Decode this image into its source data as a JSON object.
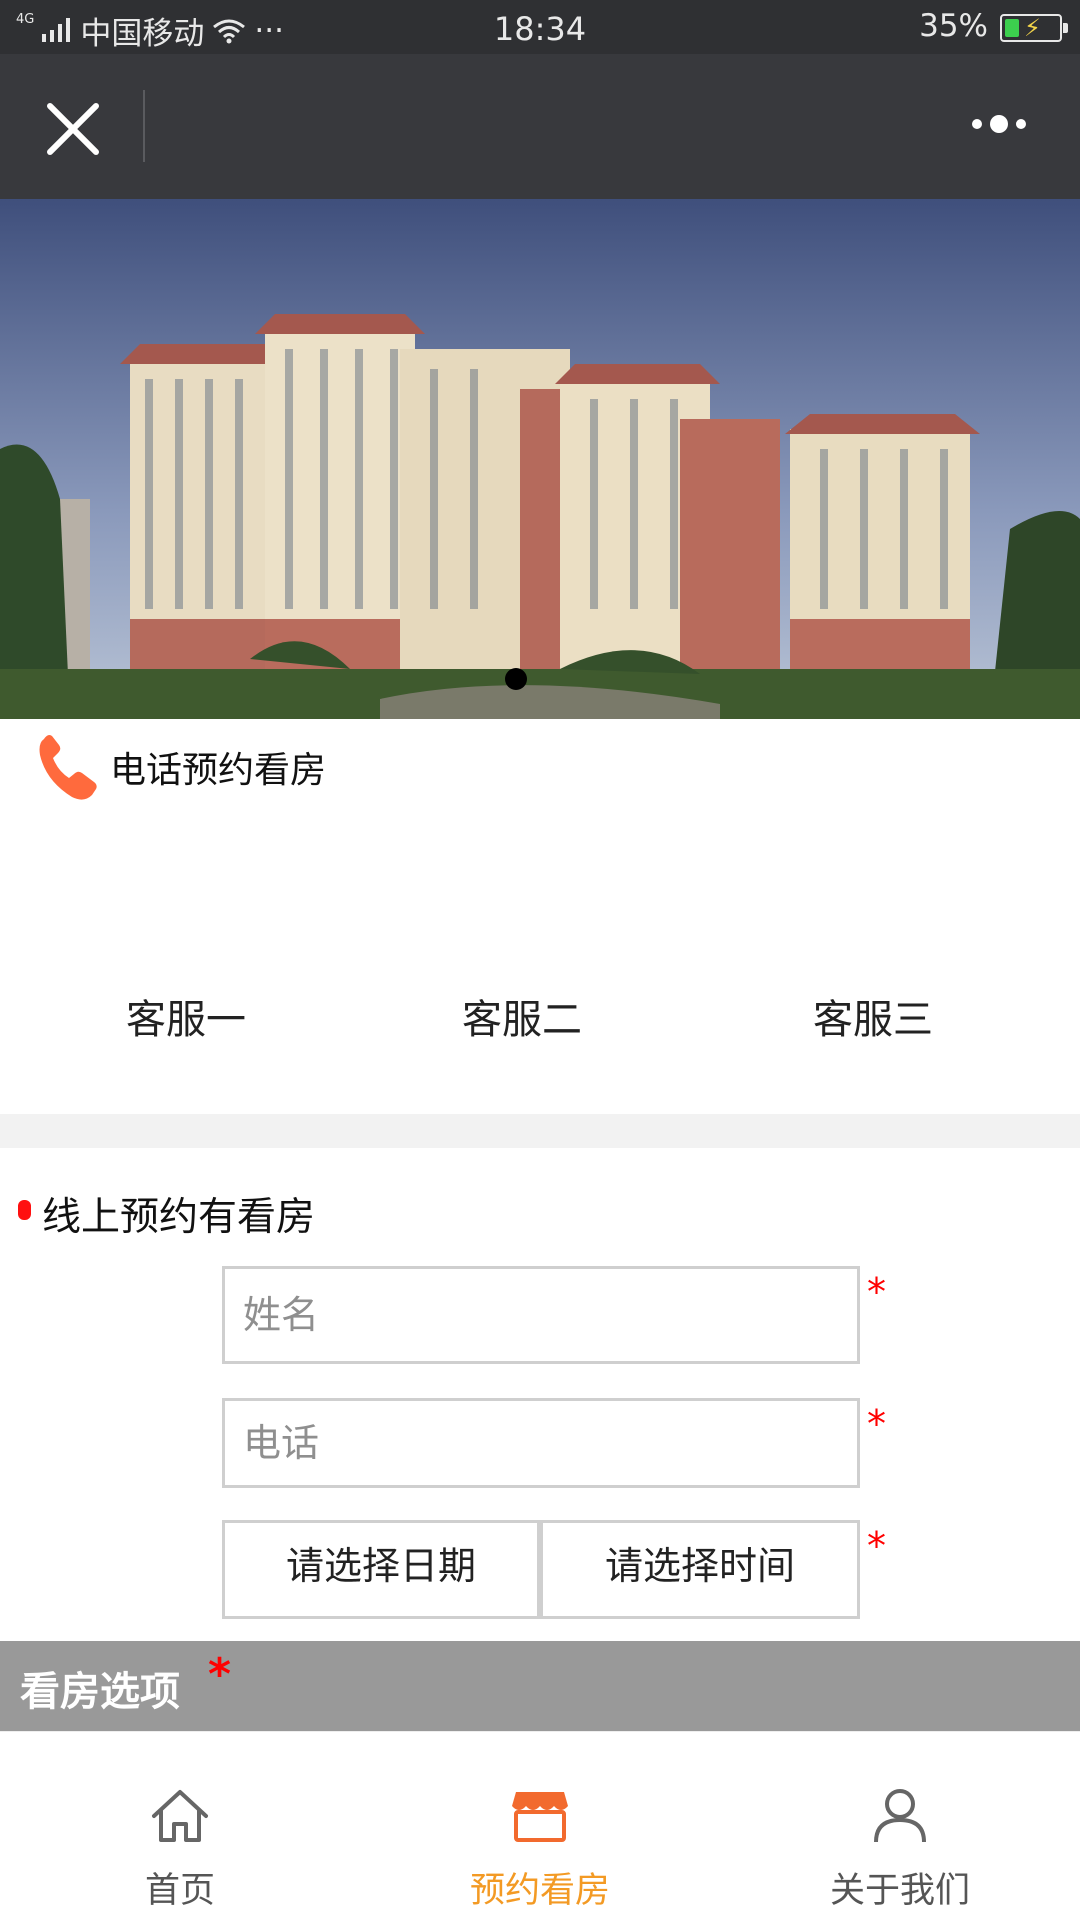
{
  "status_bar": {
    "network": "4G",
    "carrier": "中国移动",
    "dots": "···",
    "time": "18:34",
    "battery": "35%",
    "battery_level": 0.35
  },
  "title_bar": {
    "close_icon": "close-icon",
    "more_icon": "more-dots-icon"
  },
  "banner": {
    "image": "apartment-buildings-photo",
    "slide_count": 1,
    "active_slide": 1
  },
  "phone_booking": {
    "icon": "phone-icon",
    "title": "电话预约看房",
    "agents": [
      "客服一",
      "客服二",
      "客服三"
    ]
  },
  "online_booking": {
    "title": "线上预约有看房",
    "name_placeholder": "姓名",
    "phone_placeholder": "电话",
    "date_label": "请选择日期",
    "time_label": "请选择时间",
    "required_mark": "*"
  },
  "options": {
    "title": "看房选项",
    "required_mark": "*"
  },
  "tab_bar": {
    "tabs": [
      {
        "label": "首页",
        "icon": "home-icon",
        "active": false
      },
      {
        "label": "预约看房",
        "icon": "store-icon",
        "active": true
      },
      {
        "label": "关于我们",
        "icon": "user-icon",
        "active": false
      }
    ],
    "active_color": "#f39a24"
  },
  "colors": {
    "accent": "#f39a24",
    "required": "#ff0000",
    "phone_icon": "#ff6a3d",
    "header_bg": "#38393d"
  }
}
